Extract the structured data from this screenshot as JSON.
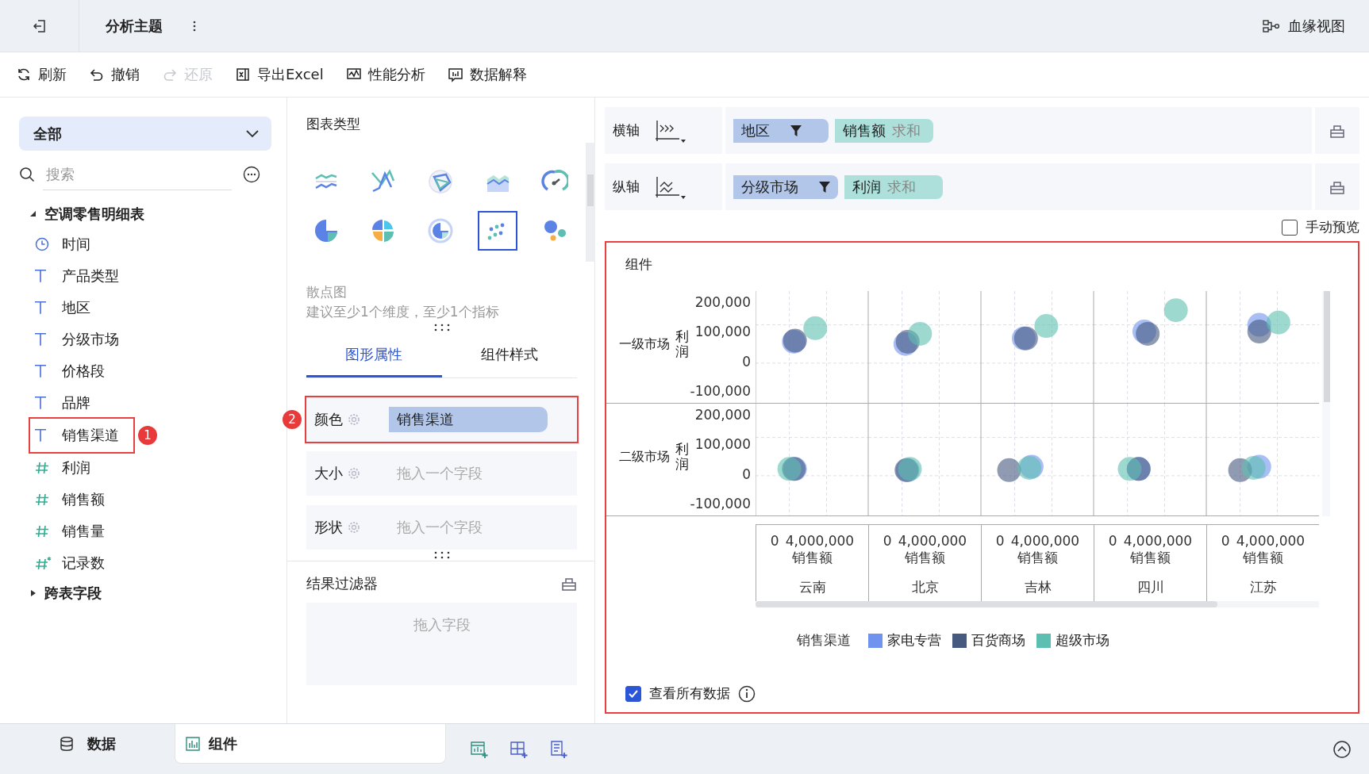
{
  "header": {
    "title": "分析主题",
    "lineage": "血缘视图"
  },
  "toolbar": [
    {
      "label": "刷新",
      "disabled": false
    },
    {
      "label": "撤销",
      "disabled": false
    },
    {
      "label": "还原",
      "disabled": true
    },
    {
      "label": "导出Excel",
      "disabled": false
    },
    {
      "label": "性能分析",
      "disabled": false
    },
    {
      "label": "数据解释",
      "disabled": false
    }
  ],
  "fields_panel": {
    "scope": "全部",
    "search": {
      "placeholder": "搜索"
    },
    "tree": [
      {
        "label": "空调零售明细表",
        "expanded": true,
        "children": [
          {
            "label": "时间",
            "kind": "time"
          },
          {
            "label": "产品类型",
            "kind": "text"
          },
          {
            "label": "地区",
            "kind": "text"
          },
          {
            "label": "分级市场",
            "kind": "text"
          },
          {
            "label": "价格段",
            "kind": "text"
          },
          {
            "label": "品牌",
            "kind": "text"
          },
          {
            "label": "销售渠道",
            "kind": "text",
            "callout": "1"
          },
          {
            "label": "利润",
            "kind": "number"
          },
          {
            "label": "销售额",
            "kind": "number"
          },
          {
            "label": "销售量",
            "kind": "number"
          },
          {
            "label": "记录数",
            "kind": "count"
          }
        ]
      },
      {
        "label": "跨表字段",
        "expanded": false
      }
    ]
  },
  "chart_panel": {
    "title": "图表类型",
    "chart_types": [
      {
        "kind": "dual-line",
        "selected": false
      },
      {
        "kind": "cross-line",
        "selected": false
      },
      {
        "kind": "radar",
        "selected": false
      },
      {
        "kind": "area",
        "selected": false
      },
      {
        "kind": "gauge",
        "selected": false
      },
      {
        "kind": "pie",
        "selected": false
      },
      {
        "kind": "rose",
        "selected": false
      },
      {
        "kind": "donut",
        "selected": false
      },
      {
        "kind": "scatter",
        "selected": true
      },
      {
        "kind": "bubble",
        "selected": false
      }
    ],
    "type_name": "散点图",
    "hint": "建议至少1个维度，至少1个指标",
    "tabs": [
      {
        "label": "图形属性",
        "selected": true
      },
      {
        "label": "组件样式",
        "selected": false
      }
    ],
    "attributes": [
      {
        "label": "颜色",
        "value": "销售渠道",
        "callout": "2"
      },
      {
        "label": "大小",
        "placeholder": "拖入一个字段"
      },
      {
        "label": "形状",
        "placeholder": "拖入一个字段"
      }
    ],
    "filter": {
      "title": "结果过滤器",
      "placeholder": "拖入字段"
    }
  },
  "axes": [
    {
      "label": "横轴",
      "fields": [
        {
          "name": "地区",
          "kind": "dimension",
          "filter": true
        },
        {
          "name": "销售额",
          "kind": "measure",
          "aggregate": "求和"
        }
      ]
    },
    {
      "label": "纵轴",
      "fields": [
        {
          "name": "分级市场",
          "kind": "dimension",
          "filter": true
        },
        {
          "name": "利润",
          "kind": "measure",
          "aggregate": "求和"
        }
      ]
    }
  ],
  "manual_preview": {
    "label": "手动预览",
    "checked": false
  },
  "component": {
    "title": "组件",
    "rows": [
      {
        "label": "一级市场",
        "y_title": "利润",
        "y_ticks": [
          "200,000",
          "100,000",
          "0",
          "-100,000"
        ]
      },
      {
        "label": "二级市场",
        "y_title": "利润",
        "y_ticks": [
          "200,000",
          "100,000",
          "0",
          "-100,000"
        ]
      }
    ],
    "columns": [
      {
        "name": "云南",
        "x_ticks": [
          "0",
          "4,000,000"
        ],
        "x_title": "销售额"
      },
      {
        "name": "北京",
        "x_ticks": [
          "0",
          "4,000,000"
        ],
        "x_title": "销售额"
      },
      {
        "name": "吉林",
        "x_ticks": [
          "0",
          "4,000,000"
        ],
        "x_title": "销售额"
      },
      {
        "name": "四川",
        "x_ticks": [
          "0",
          "4,000,000"
        ],
        "x_title": "销售额"
      },
      {
        "name": "江苏",
        "x_ticks": [
          "0",
          "4,000,000"
        ],
        "x_title": "销售额"
      }
    ],
    "legend": {
      "title": "销售渠道",
      "items": [
        {
          "label": "家电专营",
          "color": "#6f93ee"
        },
        {
          "label": "百货商场",
          "color": "#46597e"
        },
        {
          "label": "超级市场",
          "color": "#5dbfb1"
        }
      ]
    },
    "show_all": {
      "label": "查看所有数据",
      "checked": true
    }
  },
  "bottom_tabs": [
    {
      "label": "数据",
      "selected": false
    },
    {
      "label": "组件",
      "selected": true
    }
  ]
}
